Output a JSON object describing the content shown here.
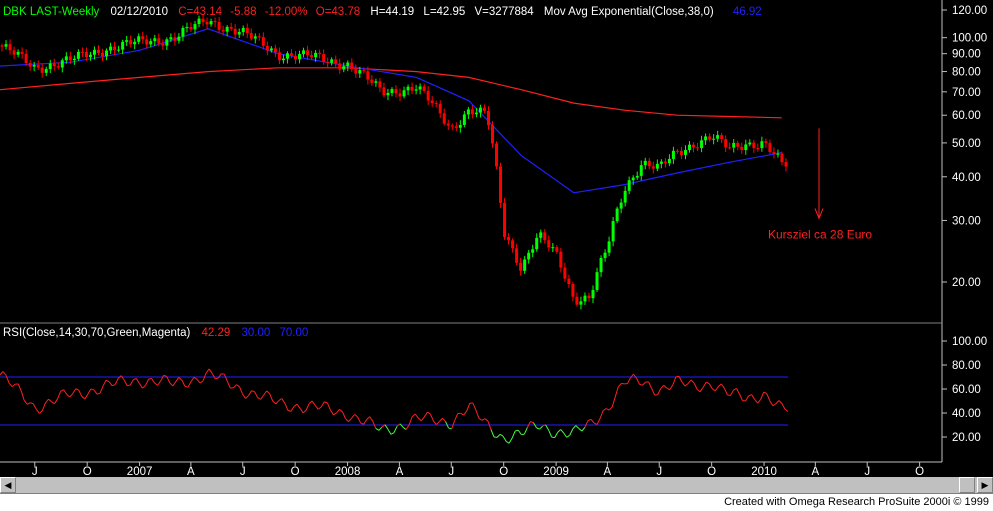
{
  "colors": {
    "background": "#000000",
    "bull_candle": "#00ff00",
    "bear_candle": "#ff0000",
    "ema38": "#2020ff",
    "ema_long": "#ff2020",
    "rsi_line": "#ff2020",
    "rsi_oversold_segment": "#40ff40",
    "rsi_bands": "#2020ff",
    "axis_text": "#ffffff",
    "annotation": "#ff2020"
  },
  "header": {
    "symbol": "DBK LAST-Weekly",
    "date": "02/12/2010",
    "close": "C=43.14",
    "change": "-5.88",
    "change_pct": "-12.00%",
    "open": "O=43.78",
    "high": "H=44.19",
    "low": "L=42.95",
    "volume": "V=3277884",
    "indicator": "Mov Avg Exponential(Close,38,0)",
    "indicator_value": "46.92"
  },
  "rsi_header": {
    "label": "RSI(Close,14,30,70,Green,Magenta)",
    "value": "42.29",
    "lower": "30.00",
    "upper": "70.00"
  },
  "annotation": {
    "text": "Kursziel ca 28 Euro",
    "from_value": 55,
    "to_value": 30
  },
  "price_axis": [
    "120.00",
    "100.00",
    "90.00",
    "80.00",
    "70.00",
    "60.00",
    "50.00",
    "40.00",
    "30.00",
    "20.00"
  ],
  "rsi_axis": [
    "100.00",
    "80.00",
    "60.00",
    "40.00",
    "20.00"
  ],
  "time_axis": [
    "J",
    "O",
    "2007",
    "A",
    "J",
    "O",
    "2008",
    "A",
    "J",
    "O",
    "2009",
    "A",
    "J",
    "O",
    "2010",
    "A",
    "J",
    "O"
  ],
  "credit": "Created with Omega Research ProSuite 2000i © 1999",
  "chart_data": [
    {
      "type": "candlestick",
      "title": "DBK LAST-Weekly",
      "frequency": "weekly",
      "x_range": [
        "2006-05",
        "2010-02-12"
      ],
      "yscale": "log",
      "ylim": [
        15,
        125
      ],
      "grid": false,
      "last_bar": {
        "date": "2010-02-12",
        "open": 43.78,
        "high": 44.19,
        "low": 42.95,
        "close": 43.14
      },
      "series": [
        {
          "name": "Mov Avg Exponential(Close,38,0)",
          "type": "line",
          "x": [
            "2006-05",
            "2006-09",
            "2007-01",
            "2007-05",
            "2007-09",
            "2008-01",
            "2008-05",
            "2008-08",
            "2008-11",
            "2009-02",
            "2009-05",
            "2009-08",
            "2009-11",
            "2010-02"
          ],
          "values": [
            83,
            85,
            92,
            106,
            90,
            83,
            77,
            66,
            46,
            36,
            38,
            41,
            44,
            46.92
          ]
        },
        {
          "type": "line",
          "x": [
            "2006-05",
            "2006-09",
            "2007-01",
            "2007-05",
            "2007-09",
            "2008-01",
            "2008-05",
            "2008-08",
            "2008-11",
            "2009-02",
            "2009-05",
            "2009-08",
            "2009-11",
            "2010-02"
          ],
          "values": [
            71,
            74,
            77,
            80,
            82,
            82,
            80,
            77,
            71,
            65,
            62,
            60,
            59.5,
            59
          ]
        },
        {
          "name": "DBK close",
          "type": "line",
          "x": [
            "2006-05",
            "2006-07",
            "2006-09",
            "2006-11",
            "2007-01",
            "2007-03",
            "2007-05",
            "2007-07",
            "2007-09",
            "2007-11",
            "2008-01",
            "2008-03",
            "2008-05",
            "2008-07",
            "2008-08",
            "2008-09",
            "2008-10",
            "2008-11",
            "2008-12",
            "2009-01",
            "2009-02",
            "2009-03",
            "2009-04",
            "2009-05",
            "2009-06",
            "2009-07",
            "2009-08",
            "2009-09",
            "2009-10",
            "2009-11",
            "2009-12",
            "2010-01",
            "2010-02"
          ],
          "values": [
            95,
            82,
            86,
            93,
            97,
            100,
            112,
            103,
            90,
            88,
            84,
            70,
            72,
            55,
            62,
            60,
            28,
            22,
            27,
            24,
            18,
            18,
            25,
            37,
            44,
            42,
            47,
            50,
            52,
            48,
            50,
            50,
            43.14
          ]
        }
      ]
    },
    {
      "type": "line",
      "title": "RSI(Close,14,30,70,Green,Magenta)",
      "ylim": [
        10,
        100
      ],
      "bands": [
        30,
        70
      ],
      "series": [
        {
          "name": "RSI(Close,14,30,70,Green,Magenta)",
          "x": [
            "2006-05",
            "2006-07",
            "2006-09",
            "2006-11",
            "2007-01",
            "2007-03",
            "2007-05",
            "2007-07",
            "2007-09",
            "2007-11",
            "2008-01",
            "2008-03",
            "2008-05",
            "2008-07",
            "2008-08",
            "2008-09",
            "2008-10",
            "2008-11",
            "2008-12",
            "2009-01",
            "2009-02",
            "2009-03",
            "2009-04",
            "2009-05",
            "2009-06",
            "2009-07",
            "2009-08",
            "2009-09",
            "2009-10",
            "2009-11",
            "2009-12",
            "2010-01",
            "2010-02"
          ],
          "values": [
            72,
            45,
            55,
            62,
            68,
            64,
            72,
            60,
            48,
            45,
            40,
            25,
            35,
            33,
            45,
            30,
            20,
            22,
            30,
            25,
            22,
            30,
            45,
            65,
            66,
            60,
            65,
            62,
            66,
            55,
            52,
            57,
            42.29
          ]
        }
      ]
    }
  ]
}
